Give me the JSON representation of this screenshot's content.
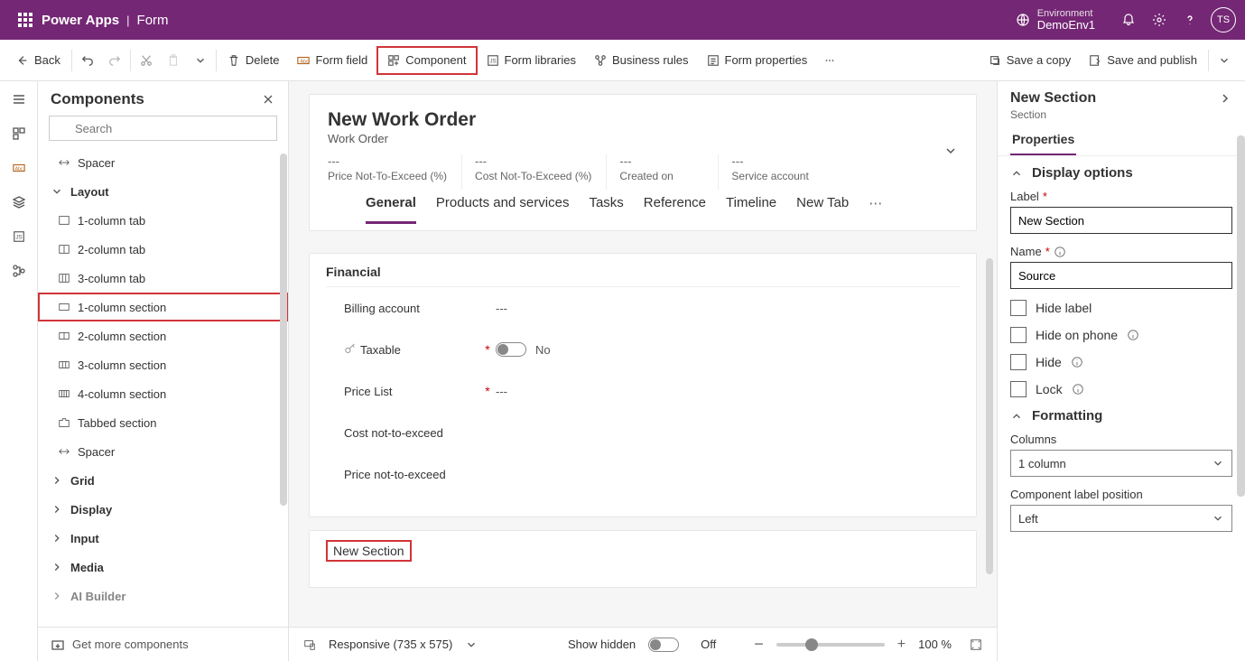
{
  "topbar": {
    "brand": "Power Apps",
    "page": "Form",
    "env_label": "Environment",
    "env_value": "DemoEnv1",
    "avatar": "TS"
  },
  "cmdbar": {
    "back": "Back",
    "delete": "Delete",
    "form_field": "Form field",
    "component": "Component",
    "form_libraries": "Form libraries",
    "business_rules": "Business rules",
    "form_properties": "Form properties",
    "save_copy": "Save a copy",
    "save_publish": "Save and publish"
  },
  "panel": {
    "title": "Components",
    "search_placeholder": "Search",
    "items": {
      "spacer1": "Spacer",
      "layout": "Layout",
      "col1tab": "1-column tab",
      "col2tab": "2-column tab",
      "col3tab": "3-column tab",
      "col1sec": "1-column section",
      "col2sec": "2-column section",
      "col3sec": "3-column section",
      "col4sec": "4-column section",
      "tabbed": "Tabbed section",
      "spacer2": "Spacer",
      "grid": "Grid",
      "display": "Display",
      "input": "Input",
      "media": "Media",
      "aibuilder": "AI Builder"
    },
    "more": "Get more components"
  },
  "form": {
    "title": "New Work Order",
    "entity": "Work Order",
    "header": [
      {
        "v": "---",
        "l": "Price Not-To-Exceed (%)"
      },
      {
        "v": "---",
        "l": "Cost Not-To-Exceed (%)"
      },
      {
        "v": "---",
        "l": "Created on"
      },
      {
        "v": "---",
        "l": "Service account"
      }
    ],
    "tabs": [
      "General",
      "Products and services",
      "Tasks",
      "Reference",
      "Timeline",
      "New Tab"
    ],
    "section_title": "Financial",
    "fields": {
      "billing": {
        "label": "Billing account",
        "value": "---"
      },
      "taxable": {
        "label": "Taxable",
        "value": "No"
      },
      "pricelist": {
        "label": "Price List",
        "value": "---"
      },
      "costnte": {
        "label": "Cost not-to-exceed"
      },
      "pricente": {
        "label": "Price not-to-exceed"
      }
    },
    "new_section": "New Section"
  },
  "footer": {
    "responsive": "Responsive (735 x 575)",
    "show_hidden": "Show hidden",
    "off": "Off",
    "zoom": "100 %"
  },
  "props": {
    "title": "New Section",
    "sub": "Section",
    "tab": "Properties",
    "display_options": "Display options",
    "label_lbl": "Label",
    "label_val": "New Section",
    "name_lbl": "Name",
    "name_val": "Source",
    "hide_label": "Hide label",
    "hide_phone": "Hide on phone",
    "hide": "Hide",
    "lock": "Lock",
    "formatting": "Formatting",
    "columns_lbl": "Columns",
    "columns_val": "1 column",
    "clp_lbl": "Component label position",
    "clp_val": "Left"
  }
}
